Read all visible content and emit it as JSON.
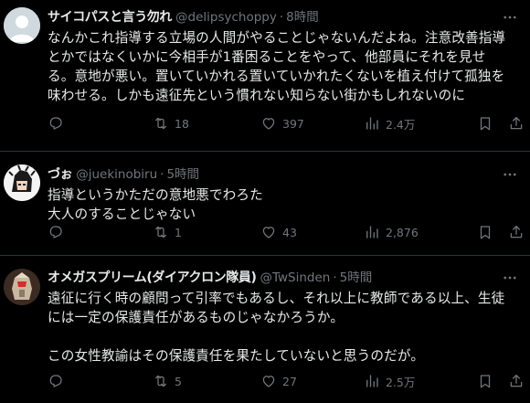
{
  "tweets": [
    {
      "name": "サイコパスと言う勿れ",
      "handle": "@delipsychoppy",
      "separator": "·",
      "time": "8時間",
      "body": "なんかこれ指導する立場の人間がやることじゃないんだよね。注意改善指導\nとかではなくいかに今相手が1番困ることをやって、他部員にそれを見せ\nる。意地が悪い。置いていかれる置いていかれたくないを植え付けて孤独を\n味わせる。しかも遠征先という慣れない知らない街かもしれないのに",
      "replies": "",
      "retweets": "18",
      "likes": "397",
      "views": "2.4万"
    },
    {
      "name": "づぉ",
      "handle": "@juekinobiru",
      "separator": "·",
      "time": "5時間",
      "body": "指導というかただの意地悪でわろた\n大人のすることじゃない",
      "replies": "",
      "retweets": "1",
      "likes": "43",
      "views": "2,876"
    },
    {
      "name": "オメガスプリーム(ダイアクロン隊員)",
      "handle": "@TwSinden",
      "separator": "·",
      "time": "5時間",
      "body": "遠征に行く時の顧問って引率でもあるし、それ以上に教師である以上、生徒\nには一定の保護責任があるものじゃなかろうか。\n\nこの女性教諭はその保護責任を果たしていないと思うのだが。",
      "replies": "",
      "retweets": "5",
      "likes": "27",
      "views": "2.5万"
    }
  ],
  "icons": {
    "more": "more-horizontal-icon",
    "reply": "reply-icon",
    "retweet": "retweet-icon",
    "like": "heart-icon",
    "views": "views-chart-icon",
    "bookmark": "bookmark-icon",
    "share": "share-icon"
  },
  "colors": {
    "background": "#000000",
    "text": "#e7e9ea",
    "muted": "#71767b",
    "divider": "#2f3336"
  }
}
